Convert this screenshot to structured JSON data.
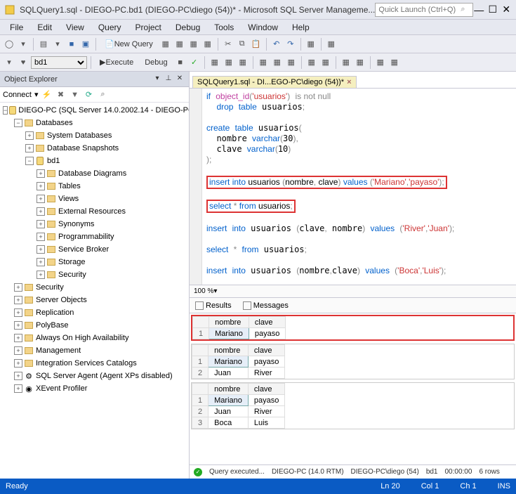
{
  "title": "SQLQuery1.sql - DIEGO-PC.bd1 (DIEGO-PC\\diego (54))* - Microsoft SQL Server Manageme...",
  "quick_launch_placeholder": "Quick Launch (Ctrl+Q)",
  "menus": [
    "File",
    "Edit",
    "View",
    "Query",
    "Project",
    "Debug",
    "Tools",
    "Window",
    "Help"
  ],
  "toolbar": {
    "new_query": "New Query",
    "db_combo": "bd1",
    "execute": "Execute",
    "debug": "Debug"
  },
  "explorer": {
    "title": "Object Explorer",
    "connect": "Connect",
    "root": "DIEGO-PC (SQL Server 14.0.2002.14 - DIEGO-PC",
    "nodes": {
      "databases": "Databases",
      "sysdb": "System Databases",
      "snap": "Database Snapshots",
      "bd1": "bd1",
      "diagrams": "Database Diagrams",
      "tables": "Tables",
      "views": "Views",
      "ext": "External Resources",
      "syn": "Synonyms",
      "prog": "Programmability",
      "sb": "Service Broker",
      "stor": "Storage",
      "sec_db": "Security",
      "sec": "Security",
      "so": "Server Objects",
      "rep": "Replication",
      "poly": "PolyBase",
      "aoha": "Always On High Availability",
      "mgmt": "Management",
      "isc": "Integration Services Catalogs",
      "agent": "SQL Server Agent (Agent XPs disabled)",
      "xe": "XEvent Profiler"
    }
  },
  "tab_label": "SQLQuery1.sql - DI...EGO-PC\\diego (54))*",
  "zoom": "100 %",
  "results_tabs": {
    "results": "Results",
    "messages": "Messages"
  },
  "grid_cols": [
    "nombre",
    "clave"
  ],
  "grid1": [
    [
      "Mariano",
      "payaso"
    ]
  ],
  "grid2": [
    [
      "Mariano",
      "payaso"
    ],
    [
      "Juan",
      "River"
    ]
  ],
  "grid3": [
    [
      "Mariano",
      "payaso"
    ],
    [
      "Juan",
      "River"
    ],
    [
      "Boca",
      "Luis"
    ]
  ],
  "qstatus": {
    "exec": "Query executed...",
    "server": "DIEGO-PC (14.0 RTM)",
    "user": "DIEGO-PC\\diego (54)",
    "db": "bd1",
    "time": "00:00:00",
    "rows": "6 rows"
  },
  "status": {
    "ready": "Ready",
    "ln": "Ln 20",
    "col": "Col 1",
    "ch": "Ch 1",
    "ins": "INS"
  }
}
